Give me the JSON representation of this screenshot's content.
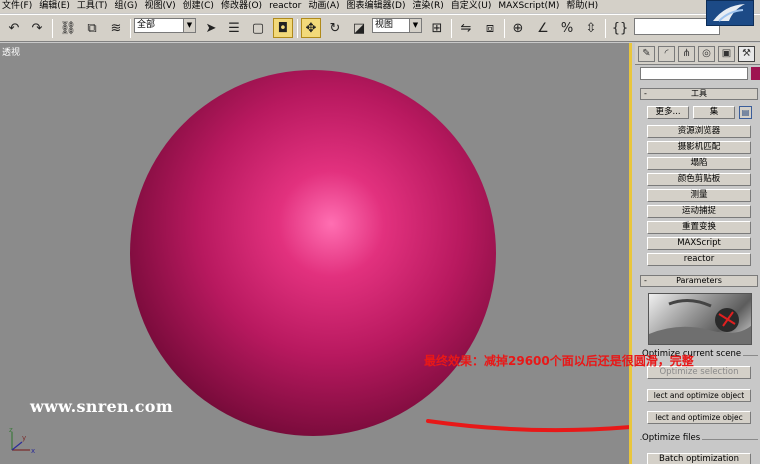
{
  "menu": {
    "items": [
      "文件(F)",
      "编辑(E)",
      "工具(T)",
      "组(G)",
      "视图(V)",
      "创建(C)",
      "修改器(O)",
      "reactor",
      "动画(A)",
      "图表编辑器(D)",
      "渲染(R)",
      "自定义(U)",
      "MAXScript(M)",
      "帮助(H)"
    ]
  },
  "toolbar": {
    "selection_filter": "全部",
    "reference_coord": "视图",
    "icons": [
      "undo-icon",
      "redo-icon",
      "select-link-icon",
      "unlink-icon",
      "bind-spacewarp-icon",
      "select-object-icon",
      "select-by-name-icon",
      "rect-selection-icon",
      "window-crossing-icon",
      "move-icon",
      "rotate-icon",
      "scale-icon",
      "pivot-center-icon",
      "mirror-icon",
      "align-icon",
      "snap-icon",
      "angle-snap-icon",
      "percent-snap-icon",
      "spinner-snap-icon",
      "named-selection-icon"
    ]
  },
  "viewport": {
    "label": "透视",
    "watermark": "www.snren.com",
    "annotation": "最终效果：减掉29600个面以后还是很圆滑，完整",
    "sphere_color": "#c2185b",
    "background_color": "#8b8b8b",
    "active_border_color": "#e9c63c"
  },
  "panel": {
    "tabs": [
      "create-tab-icon",
      "modify-tab-icon",
      "hierarchy-tab-icon",
      "motion-tab-icon",
      "display-tab-icon",
      "utilities-tab-icon"
    ],
    "utilities_rollout": {
      "title": "工具",
      "collapse": "-",
      "more_label": "更多...",
      "sets_label": "集",
      "buttons": [
        "资源浏览器",
        "摄影机匹配",
        "塌陷",
        "颜色剪贴板",
        "测量",
        "运动捕捉",
        "重置变换",
        "MAXScript",
        "reactor"
      ]
    },
    "parameters_rollout": {
      "title": "Parameters",
      "collapse": "-",
      "optimize_scene_label": "Optimize current scene",
      "optimize_selection_label": "Optimize selection",
      "select_optimize_label_1": "lect and optimize object",
      "select_optimize_label_2": "lect and optimize objec",
      "optimize_files_label": "Optimize files",
      "batch_label": "Batch optimization"
    }
  }
}
